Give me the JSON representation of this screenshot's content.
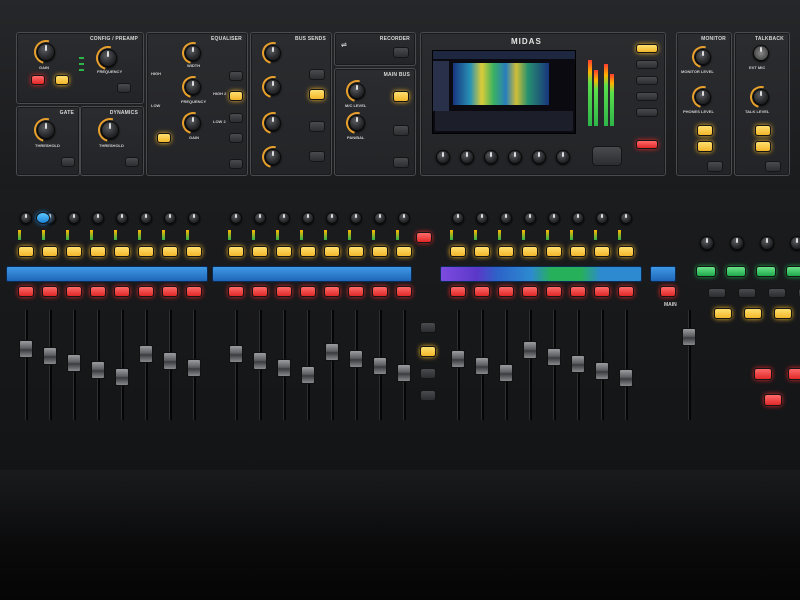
{
  "brand": "MIDAS",
  "colors": {
    "accent_yellow": "#f2b72a",
    "accent_red": "#e02828",
    "accent_blue": "#1c82d6",
    "accent_green": "#1fa94a",
    "panel_bg": "#232427"
  },
  "top_panels": {
    "config": {
      "title": "CONFIG / PREAMP",
      "gain_label": "GAIN",
      "freq_label": "FREQUENCY"
    },
    "gate": {
      "title": "GATE",
      "threshold_label": "THRESHOLD"
    },
    "dynamics": {
      "title": "DYNAMICS",
      "threshold_label": "THRESHOLD"
    },
    "equaliser": {
      "title": "EQUALISER",
      "width_label": "WIDTH",
      "freq_label": "FREQUENCY",
      "gain_label": "GAIN",
      "high_label": "HIGH",
      "low_label": "LOW",
      "high2_label": "HIGH 2",
      "low2_label": "LOW 2"
    },
    "bus_sends": {
      "title": "BUS SENDS"
    },
    "recorder": {
      "title": "RECORDER"
    },
    "main_bus": {
      "title": "MAIN BUS",
      "mc_label": "M/C LEVEL",
      "pan_label": "PAN/BAL"
    },
    "monitor": {
      "title": "MONITOR",
      "monitor_level": "MONITOR LEVEL",
      "phones_level": "PHONES LEVEL"
    },
    "talkback": {
      "title": "TALKBACK",
      "ext_mic": "EXT MIC",
      "talk_level": "TALK LEVEL"
    }
  },
  "deck": {
    "main_label": "MAIN"
  }
}
